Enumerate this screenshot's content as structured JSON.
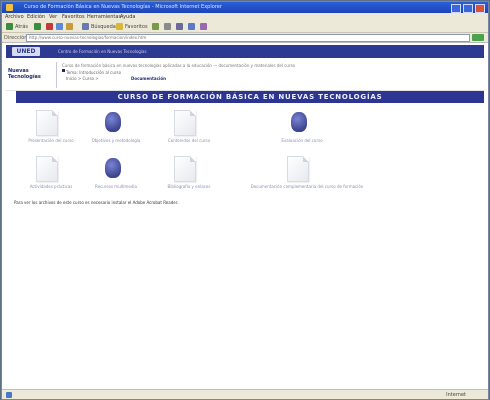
{
  "window": {
    "title": "Curso de Formación Básica en Nuevas Tecnologías - Microsoft Internet Explorer"
  },
  "menu": [
    "Archivo",
    "Edición",
    "Ver",
    "Favoritos",
    "Herramientas",
    "Ayuda"
  ],
  "toolbar": {
    "back_label": "Atrás",
    "search_label": "Búsqueda",
    "favorites_label": "Favoritos"
  },
  "address": {
    "label": "Dirección",
    "url": "http://www.curso-nuevas-tecnologias/formacion/index.htm"
  },
  "banner": {
    "logo": "UNED",
    "text": "Centro de Formación en Nuevas Tecnologías"
  },
  "nav": {
    "label": "Nuevas Tecnologías",
    "description": "Curso de formación básica en nuevas tecnologías aplicadas a la educación — documentación y materiales del curso",
    "line2": "Tema: Introducción al curso",
    "line3": "Inicio > Curso >",
    "link": "Documentación"
  },
  "course_title": "CURSO DE FORMACIÓN BÁSICA EN NUEVAS TECNOLOGÍAS",
  "items": [
    {
      "label": "Presentación del curso",
      "icon": "document-icon"
    },
    {
      "label": "Objetivos y metodología",
      "icon": "seal-icon"
    },
    {
      "label": "Contenidos del curso",
      "icon": "document-icon"
    },
    {
      "label": "Evaluación del curso",
      "icon": "seal-icon"
    },
    {
      "label": "Actividades prácticas",
      "icon": "document-icon"
    },
    {
      "label": "Recursos multimedia",
      "icon": "seal-icon"
    },
    {
      "label": "Bibliografía y enlaces",
      "icon": "document-icon"
    },
    {
      "label": "Documentación complementaria del curso de formación",
      "icon": "document-icon"
    }
  ],
  "footnote": "Para ver los archivos de este curso es necesario instalar el Adobe Acrobat Reader.",
  "status": {
    "zone": "Internet"
  },
  "colors": {
    "banner": "#2d3a92",
    "course_bar": "#2c3591"
  }
}
